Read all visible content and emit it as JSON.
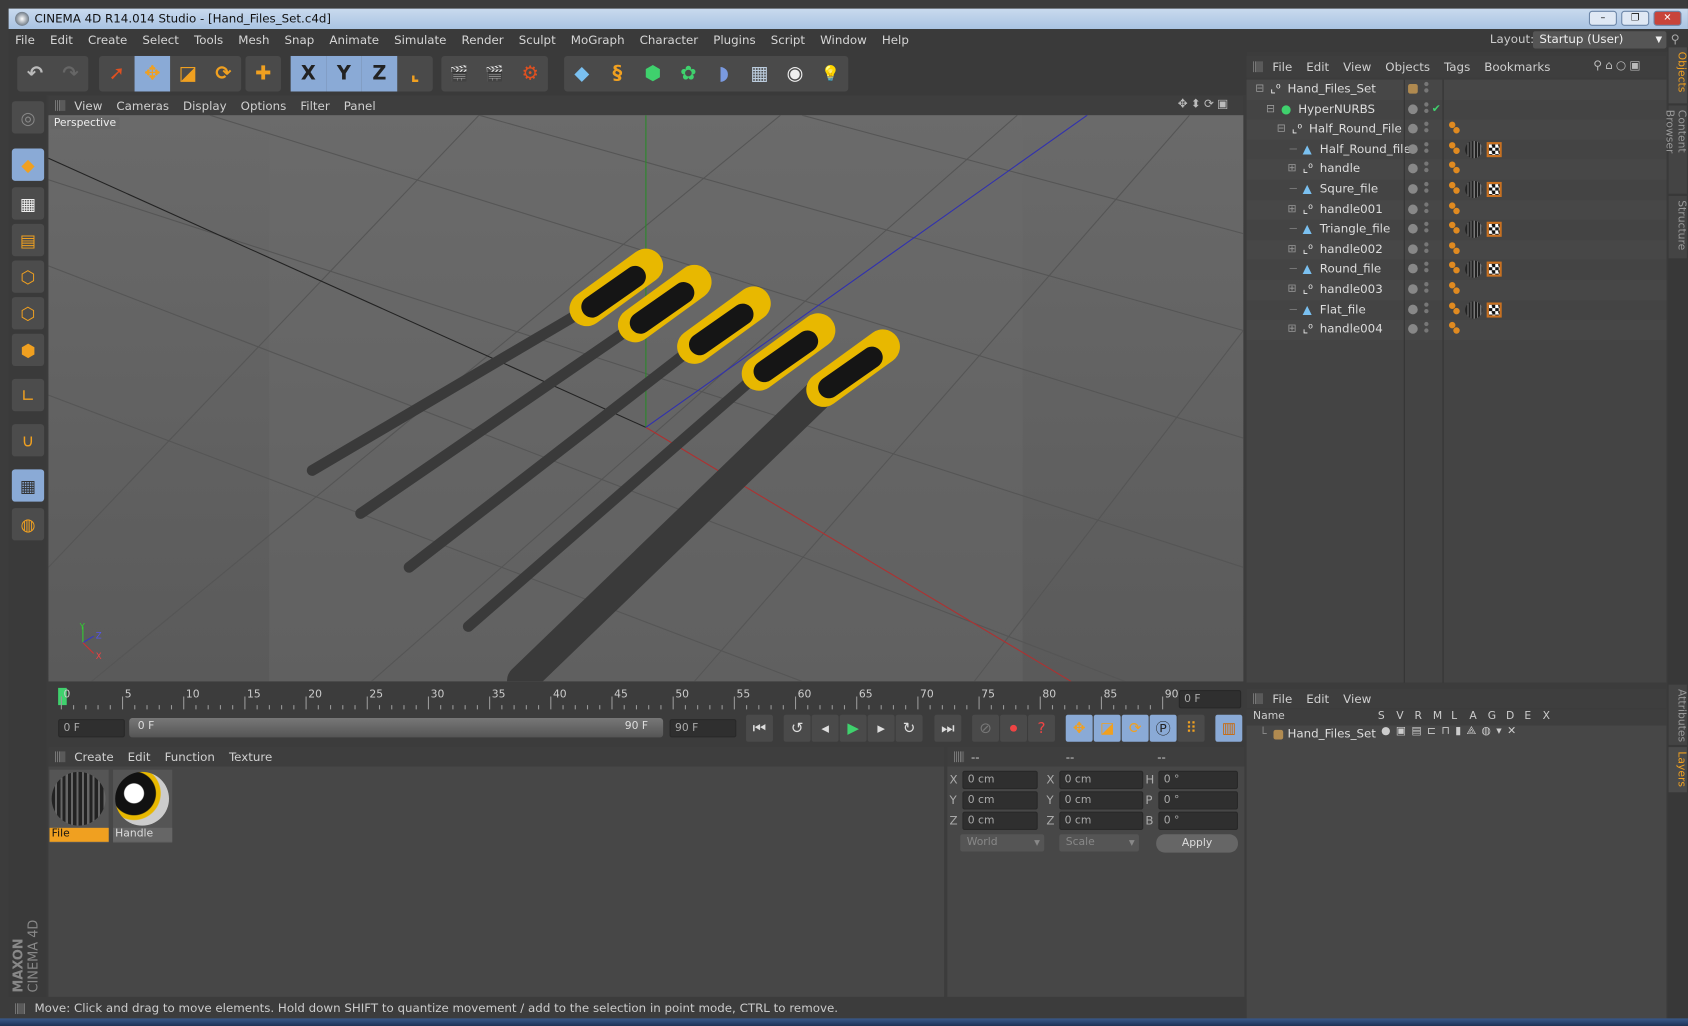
{
  "window": {
    "title": "CINEMA 4D R14.014 Studio - [Hand_Files_Set.c4d]",
    "minimize": "–",
    "restore": "❐",
    "close": "✕"
  },
  "menu": [
    "File",
    "Edit",
    "Create",
    "Select",
    "Tools",
    "Mesh",
    "Snap",
    "Animate",
    "Simulate",
    "Render",
    "Sculpt",
    "MoGraph",
    "Character",
    "Plugins",
    "Script",
    "Window",
    "Help"
  ],
  "layout": {
    "label": "Layout:",
    "value": "Startup (User)"
  },
  "toolbar": {
    "undo": "↶",
    "redo": "↷",
    "select": "➚",
    "move": "✥",
    "scale": "◪",
    "rotate": "⟳",
    "add": "✚",
    "x": "X",
    "y": "Y",
    "z": "Z",
    "coord": "⌞",
    "render_view": "🎬",
    "render": "🎬",
    "render_settings": "⚙",
    "cube": "◆",
    "spline": "§",
    "nurbs": "⬢",
    "mograph": "✿",
    "deformer": "◗",
    "floor": "▦",
    "camera": "◉",
    "light": "💡"
  },
  "viewport": {
    "menu": [
      "View",
      "Cameras",
      "Display",
      "Options",
      "Filter",
      "Panel"
    ],
    "label": "Perspective",
    "axes": {
      "x": "X",
      "y": "Y",
      "z": "Z"
    }
  },
  "objects": {
    "menu": [
      "File",
      "Edit",
      "View",
      "Objects",
      "Tags",
      "Bookmarks"
    ],
    "rows": [
      {
        "name": "Hand_Files_Set",
        "type": "null",
        "depth": 0,
        "expand": "⊟"
      },
      {
        "name": "HyperNURBS",
        "type": "nurbs",
        "depth": 1,
        "expand": "⊟",
        "check": "✔"
      },
      {
        "name": "Half_Round_File",
        "type": "null",
        "depth": 2,
        "expand": "⊟"
      },
      {
        "name": "Half_Round_file",
        "type": "poly",
        "depth": 3,
        "expand": ""
      },
      {
        "name": "handle",
        "type": "null",
        "depth": 3,
        "expand": "⊞"
      },
      {
        "name": "Squre_file",
        "type": "poly",
        "depth": 3,
        "expand": ""
      },
      {
        "name": "handle001",
        "type": "null",
        "depth": 3,
        "expand": "⊞"
      },
      {
        "name": "Triangle_file",
        "type": "poly",
        "depth": 3,
        "expand": ""
      },
      {
        "name": "handle002",
        "type": "null",
        "depth": 3,
        "expand": "⊞"
      },
      {
        "name": "Round_file",
        "type": "poly",
        "depth": 3,
        "expand": ""
      },
      {
        "name": "handle003",
        "type": "null",
        "depth": 3,
        "expand": "⊞"
      },
      {
        "name": "Flat_file",
        "type": "poly",
        "depth": 3,
        "expand": ""
      },
      {
        "name": "handle004",
        "type": "null",
        "depth": 3,
        "expand": "⊞"
      }
    ]
  },
  "timeline": {
    "ticks": [
      "0",
      "5",
      "10",
      "15",
      "20",
      "25",
      "30",
      "35",
      "40",
      "45",
      "50",
      "55",
      "60",
      "65",
      "70",
      "75",
      "80",
      "85",
      "90"
    ],
    "current_frame": "0 F",
    "start": "0 F",
    "range_start": "0 F",
    "range_end": "90 F",
    "end": "90 F"
  },
  "materials": {
    "menu": [
      "Create",
      "Edit",
      "Function",
      "Texture"
    ],
    "items": [
      {
        "name": "File",
        "selected": true
      },
      {
        "name": "Handle",
        "selected": false
      }
    ]
  },
  "coordinates": {
    "headers": [
      "--",
      "--",
      "--"
    ],
    "rows": [
      {
        "a": "X",
        "av": "0 cm",
        "b": "X",
        "bv": "0 cm",
        "c": "H",
        "cv": "0 °"
      },
      {
        "a": "Y",
        "av": "0 cm",
        "b": "Y",
        "bv": "0 cm",
        "c": "P",
        "cv": "0 °"
      },
      {
        "a": "Z",
        "av": "0 cm",
        "b": "Z",
        "bv": "0 cm",
        "c": "B",
        "cv": "0 °"
      }
    ],
    "mode": "World",
    "size_mode": "Scale",
    "apply": "Apply"
  },
  "layers": {
    "menu": [
      "File",
      "Edit",
      "View"
    ],
    "columns": [
      "Name",
      "S",
      "V",
      "R",
      "M",
      "L",
      "A",
      "G",
      "D",
      "E",
      "X"
    ],
    "rows": [
      {
        "name": "Hand_Files_Set"
      }
    ]
  },
  "right_tabs": [
    "Objects",
    "Content Browser",
    "Structure",
    "Attributes",
    "Layers"
  ],
  "status": "Move: Click and drag to move elements. Hold down SHIFT to quantize movement / add to the selection in point mode, CTRL to remove.",
  "brand": {
    "line1": "MAXON",
    "line2": "CINEMA 4D"
  },
  "colors": {
    "accent": "#f0a020",
    "selection": "#8aaad6",
    "play": "#3fd16d",
    "handle_yellow": "#e8b800"
  }
}
